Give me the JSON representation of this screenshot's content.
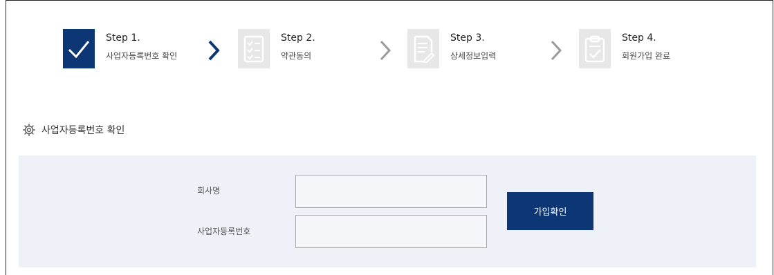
{
  "steps": [
    {
      "title": "Step 1.",
      "desc": "사업자등록번호 확인",
      "state": "active",
      "icon": "check-icon"
    },
    {
      "title": "Step 2.",
      "desc": "약관동의",
      "state": "inactive",
      "icon": "checklist-icon"
    },
    {
      "title": "Step 3.",
      "desc": "상세정보입력",
      "state": "inactive",
      "icon": "edit-document-icon"
    },
    {
      "title": "Step 4.",
      "desc": "회원가입 완료",
      "state": "inactive",
      "icon": "clipboard-check-icon"
    }
  ],
  "section": {
    "title": "사업자등록번호 확인",
    "icon": "gear-icon"
  },
  "form": {
    "company_label": "회사명",
    "company_value": "",
    "bizno_label": "사업자등록번호",
    "bizno_value": "",
    "submit_label": "가입확인"
  },
  "colors": {
    "accent": "#0d3675",
    "panel": "#eef2f8",
    "inactive_step": "#e7e7e7",
    "arrow_active": "#0d3675",
    "arrow_inactive": "#9a9a9a"
  }
}
